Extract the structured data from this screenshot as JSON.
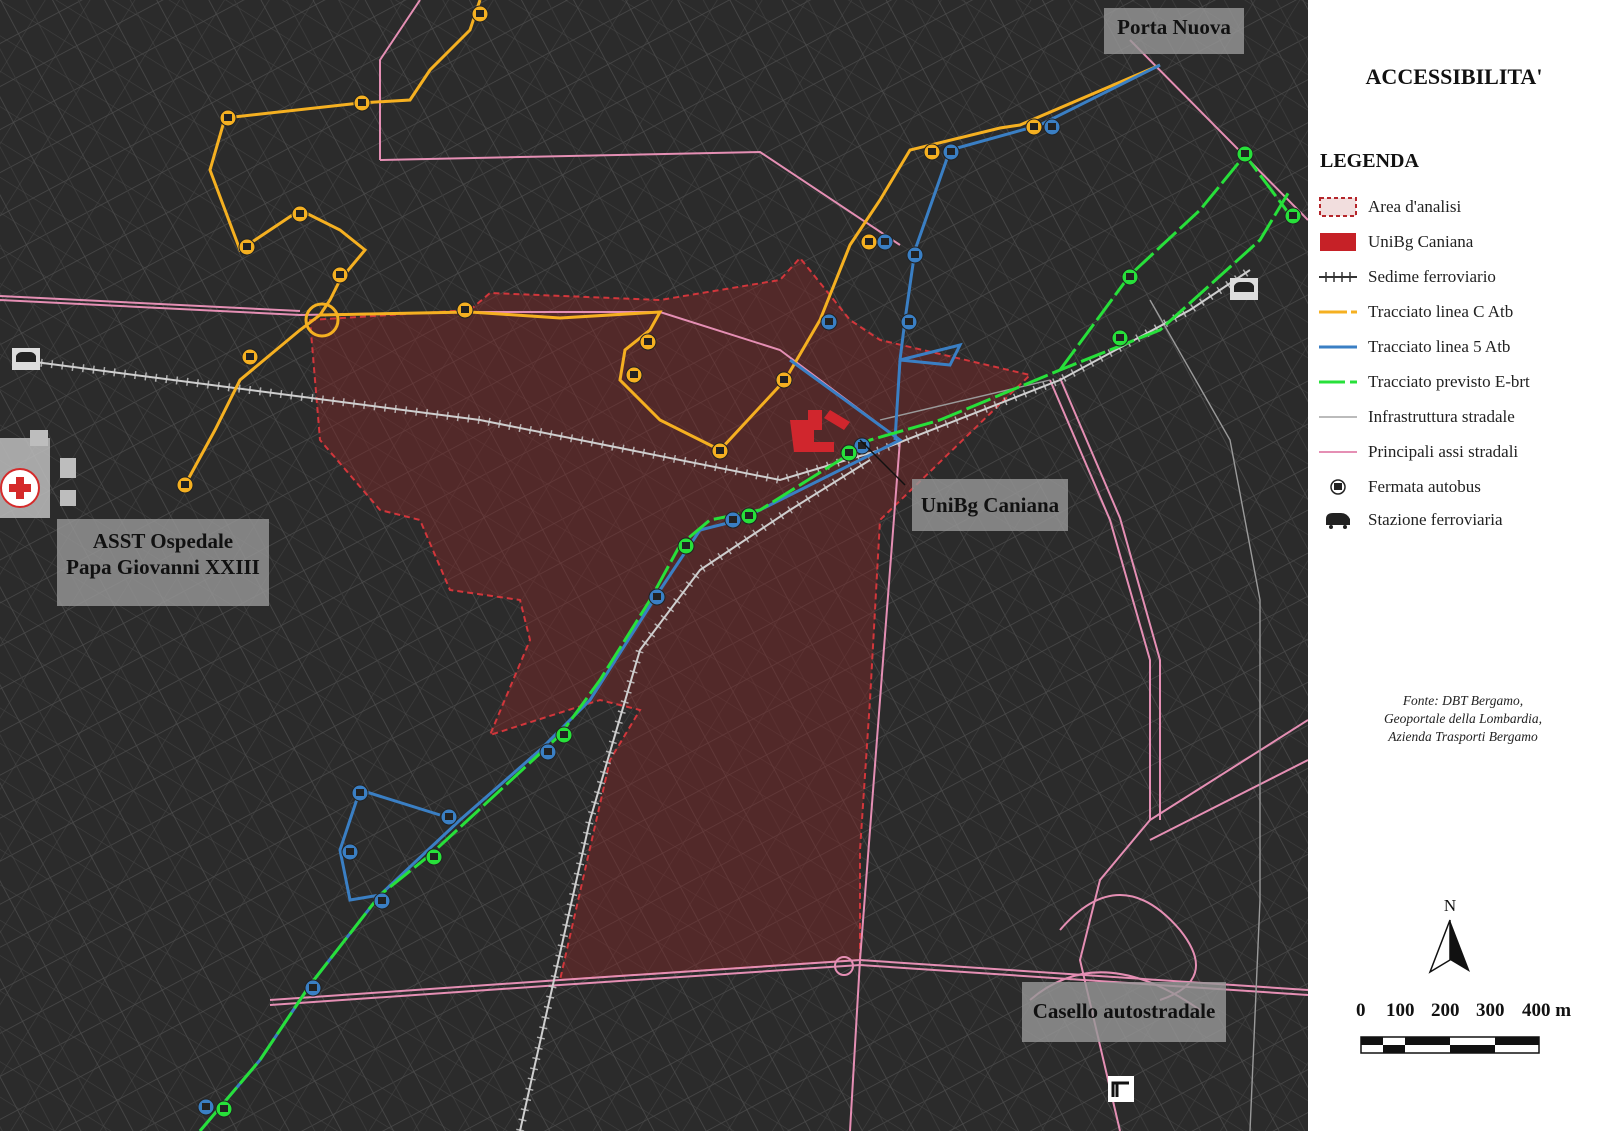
{
  "map": {
    "labels": {
      "porta_nuova": "Porta Nuova",
      "unibg": "UniBg Caniana",
      "ospedale_line1": "ASST Ospedale",
      "ospedale_line2": "Papa Giovanni XXIII",
      "casello": "Casello autostradale"
    },
    "colors": {
      "background": "#2b2b2b",
      "street": "#555555",
      "main_road": "#e58fb4",
      "line_c": "#f5b021",
      "line_5": "#3a7fc4",
      "ebrt": "#27e03a",
      "area": "#c0272d",
      "railway": "#bbbbbb"
    }
  },
  "panel": {
    "title": "ACCESSIBILITA'",
    "legend_title": "LEGENDA",
    "legend": [
      {
        "label": "Area d'analisi",
        "icon": "area-dashed-icon"
      },
      {
        "label": "UniBg Caniana",
        "icon": "area-solid-icon"
      },
      {
        "label": "Sedime ferroviario",
        "icon": "railway-icon"
      },
      {
        "label": "Tracciato linea C Atb",
        "icon": "line-c-icon"
      },
      {
        "label": "Tracciato linea 5 Atb",
        "icon": "line-5-icon"
      },
      {
        "label": "Tracciato previsto E-brt",
        "icon": "ebrt-icon"
      },
      {
        "label": "Infrastruttura stradale",
        "icon": "road-icon"
      },
      {
        "label": "Principali assi stradali",
        "icon": "main-road-icon"
      },
      {
        "label": "Fermata autobus",
        "icon": "bus-stop-icon"
      },
      {
        "label": "Stazione ferroviaria",
        "icon": "train-station-icon"
      }
    ],
    "source_lines": [
      "Fonte: DBT Bergamo,",
      "Geoportale della Lombardia,",
      "Azienda Trasporti Bergamo"
    ],
    "north_label": "N",
    "scale": {
      "ticks": [
        "0",
        "100",
        "200",
        "300",
        "400 m"
      ]
    }
  }
}
